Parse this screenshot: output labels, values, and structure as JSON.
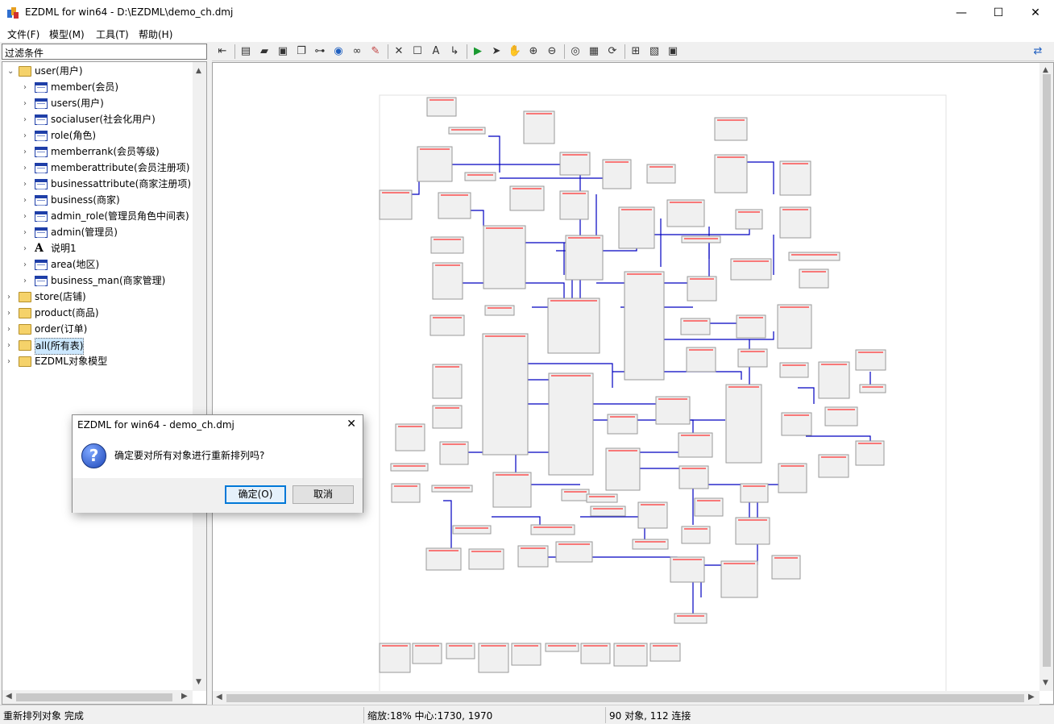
{
  "window": {
    "title": "EZDML for win64 - D:\\EZDML\\demo_ch.dmj",
    "minimize": "—",
    "maximize": "☐",
    "close": "✕"
  },
  "menu": {
    "file": "文件(F)",
    "model": "模型(M)",
    "tools": "工具(T)",
    "help": "帮助(H)"
  },
  "filter": {
    "value": "过滤条件"
  },
  "tree": {
    "nodes": [
      {
        "label": "user(用户)",
        "type": "folder",
        "level": 0,
        "expanded": true
      },
      {
        "label": "member(会员)",
        "type": "table",
        "level": 1
      },
      {
        "label": "users(用户)",
        "type": "table",
        "level": 1
      },
      {
        "label": "socialuser(社会化用户)",
        "type": "table",
        "level": 1
      },
      {
        "label": "role(角色)",
        "type": "table",
        "level": 1
      },
      {
        "label": "memberrank(会员等级)",
        "type": "table",
        "level": 1
      },
      {
        "label": "memberattribute(会员注册项)",
        "type": "table",
        "level": 1
      },
      {
        "label": "businessattribute(商家注册项)",
        "type": "table",
        "level": 1
      },
      {
        "label": "business(商家)",
        "type": "table",
        "level": 1
      },
      {
        "label": "admin_role(管理员角色中间表)",
        "type": "table",
        "level": 1
      },
      {
        "label": "admin(管理员)",
        "type": "table",
        "level": 1
      },
      {
        "label": "说明1",
        "type": "text",
        "level": 1
      },
      {
        "label": "area(地区)",
        "type": "table",
        "level": 1
      },
      {
        "label": "business_man(商家管理)",
        "type": "table",
        "level": 1
      },
      {
        "label": "store(店铺)",
        "type": "folder",
        "level": 0
      },
      {
        "label": "product(商品)",
        "type": "folder",
        "level": 0
      },
      {
        "label": "order(订单)",
        "type": "folder",
        "level": 0
      },
      {
        "label": "all(所有表)",
        "type": "folder",
        "level": 0,
        "selected": true
      },
      {
        "label": "EZDML对象模型",
        "type": "folder",
        "level": 0
      }
    ]
  },
  "toolbar": {
    "icons": [
      "back-icon",
      "new-icon",
      "open-icon",
      "save-icon",
      "copy-icon",
      "tree-icon",
      "globe-icon",
      "binoculars-icon",
      "pencil-icon",
      "delete-icon",
      "box-icon",
      "text-icon",
      "link-icon",
      "run-icon",
      "pointer-icon",
      "hand-icon",
      "zoom-in-icon",
      "zoom-out-icon",
      "eye-icon",
      "image-icon",
      "refresh-icon",
      "add-icon",
      "properties-icon",
      "fit-icon",
      "switch-icon"
    ],
    "glyphs": [
      "⇤",
      "▤",
      "▰",
      "▣",
      "❐",
      "⊶",
      "◉",
      "∞",
      "✎",
      "✕",
      "☐",
      "A",
      "↳",
      "▶",
      "➤",
      "✋",
      "⊕",
      "⊖",
      "◎",
      "▦",
      "⟳",
      "⊞",
      "▧",
      "▣",
      "⇄"
    ]
  },
  "dialog": {
    "title": "EZDML for win64 - demo_ch.dmj",
    "close": "✕",
    "icon": "question-icon",
    "icon_glyph": "?",
    "message": "确定要对所有对象进行重新排列吗?",
    "ok_label": "确定(O)",
    "cancel_label": "取消"
  },
  "status": {
    "message": "重新排列对象 完成",
    "zoom_center": "缩放:18% 中心:1730, 1970",
    "counts": "90 对象, 112 连接"
  },
  "colors": {
    "entity_fill": "#f0f0f0",
    "entity_border": "#999999",
    "entity_title": "#ff0000",
    "link": "#0000c0",
    "selection": "#cce8ff",
    "accent": "#0078d7"
  }
}
